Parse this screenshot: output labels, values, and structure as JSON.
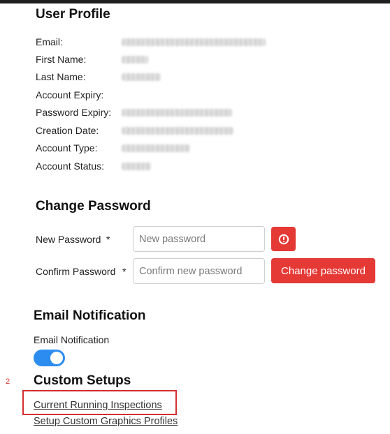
{
  "user_profile": {
    "title": "User Profile",
    "fields": [
      {
        "label": "Email:"
      },
      {
        "label": "First Name:"
      },
      {
        "label": "Last Name:"
      },
      {
        "label": "Account Expiry:"
      },
      {
        "label": "Password Expiry:"
      },
      {
        "label": "Creation Date:"
      },
      {
        "label": "Account Type:"
      },
      {
        "label": "Account Status:"
      }
    ]
  },
  "change_password": {
    "title": "Change Password",
    "new_label": "New Password",
    "confirm_label": "Confirm Password",
    "required_mark": "*",
    "new_placeholder": "New password",
    "confirm_placeholder": "Confirm new password",
    "submit_label": "Change password",
    "error_icon": "alert-circle-icon"
  },
  "email_notification": {
    "title": "Email Notification",
    "toggle_label": "Email Notification",
    "toggle_state": "on"
  },
  "custom_setups": {
    "title": "Custom Setups",
    "marker": "2",
    "links": [
      {
        "label": "Current Running Inspections"
      },
      {
        "label": "Setup Custom Graphics Profiles"
      }
    ]
  },
  "colors": {
    "accent_red": "#e53935",
    "toggle_blue": "#2d8cf0",
    "highlight_red": "#d32f2f"
  }
}
